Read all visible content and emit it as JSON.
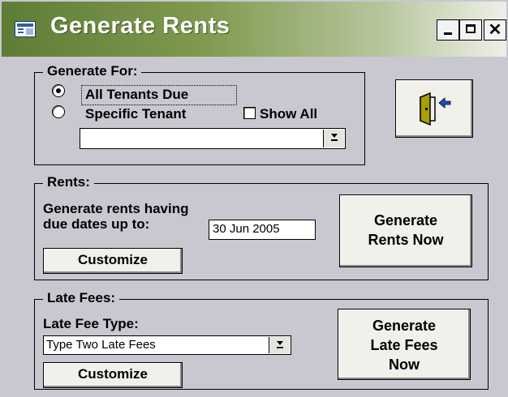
{
  "window": {
    "title": "Generate Rents",
    "controls": [
      "minimize",
      "maximize",
      "close"
    ]
  },
  "generate_for": {
    "legend": "Generate For:",
    "options": [
      {
        "label": "All Tenants Due",
        "selected": true
      },
      {
        "label": "Specific Tenant",
        "selected": false
      }
    ],
    "show_all": {
      "label": "Show All",
      "checked": false
    },
    "tenant_combo": {
      "value": ""
    }
  },
  "exit_button": {
    "icon": "exit-door-icon"
  },
  "rents": {
    "legend": "Rents:",
    "description_line1": "Generate rents having",
    "description_line2": "due dates up to:",
    "due_date": "30 Jun 2005",
    "customize_label": "Customize",
    "generate_lines": [
      "Generate",
      "Rents Now"
    ]
  },
  "late_fees": {
    "legend": "Late Fees:",
    "type_label": "Late Fee Type:",
    "type_value": "Type Two Late Fees",
    "customize_label": "Customize",
    "generate_lines": [
      "Generate",
      "Late Fees",
      "Now"
    ]
  },
  "colors": {
    "title_gradient_start": "#5e7d34",
    "title_gradient_end": "#eef0e8",
    "panel_background": "#c9c7d0",
    "button_face": "#f2f0ea",
    "door_icon": "#a8a000",
    "arrow_icon": "#1a4ecb"
  }
}
